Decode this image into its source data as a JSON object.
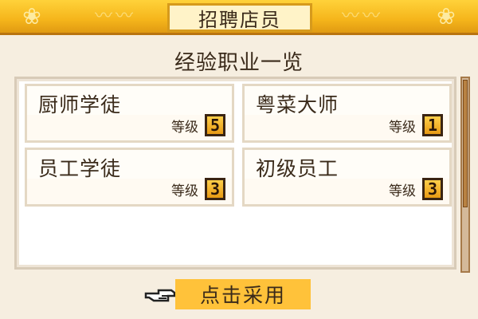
{
  "header": {
    "title": "招聘店员"
  },
  "subtitle": "经验职业一览",
  "jobs": [
    {
      "name": "厨师学徒",
      "level_label": "等级",
      "level": "5"
    },
    {
      "name": "粤菜大师",
      "level_label": "等级",
      "level": "1"
    },
    {
      "name": "员工学徒",
      "level_label": "等级",
      "level": "3"
    },
    {
      "name": "初级员工",
      "level_label": "等级",
      "level": "3"
    }
  ],
  "actions": {
    "adopt_label": "点击采用",
    "pointer_icon": "pointing-hand-icon"
  },
  "colors": {
    "header_gold": "#f5b51b",
    "button_gold": "#ffc23a",
    "background": "#f6eee0",
    "text": "#3a2a1a"
  }
}
